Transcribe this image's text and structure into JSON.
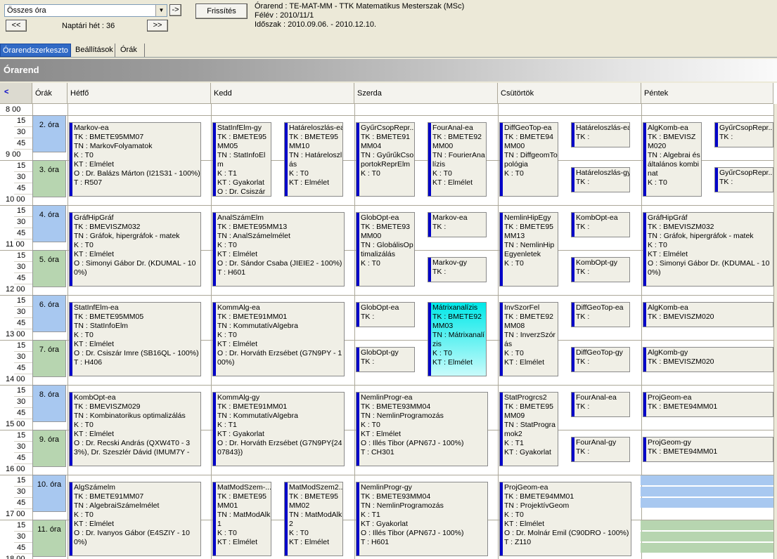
{
  "toolbar": {
    "combo_value": "Összes óra",
    "go_label": "->",
    "prev_label": "<<",
    "next_label": ">>",
    "week_label": "Naptári hét : 36",
    "refresh_label": "Frissítés"
  },
  "info": {
    "line1": "Órarend : TE-MAT-MM - TTK Matematikus Mesterszak (MSc)",
    "line2": "Félév : 2010/11/1",
    "line3": "Időszak : 2010.09.06. - 2010.12.10."
  },
  "tabs": [
    "Órarendszerkeszto",
    "Beállítások",
    "Órák"
  ],
  "banner": "Órarend",
  "columns": {
    "nav": "<",
    "periods": "Órák",
    "days": [
      "Hétfő",
      "Kedd",
      "Szerda",
      "Csütörtök",
      "Péntek"
    ]
  },
  "times": [
    "8 00",
    "15",
    "30",
    "45",
    "9 00",
    "15",
    "30",
    "45",
    "10 00",
    "15",
    "30",
    "45",
    "11 00",
    "15",
    "30",
    "45",
    "12 00",
    "15",
    "30",
    "45",
    "13 00",
    "15",
    "30",
    "45",
    "14 00",
    "15",
    "30",
    "45",
    "15 00",
    "15",
    "30",
    "45",
    "16 00",
    "15",
    "30",
    "45",
    "17 00",
    "15",
    "30",
    "45",
    "18 00"
  ],
  "periods": [
    "2. óra",
    "3. óra",
    "4. óra",
    "5. óra",
    "6. óra",
    "7. óra",
    "8. óra",
    "9. óra",
    "10. óra",
    "11. óra"
  ],
  "events": [
    {
      "title": "Markov-ea",
      "lines": [
        "TK : BMETE95MM07",
        "TN : MarkovFolyamatok",
        "K : T0",
        "KT : Elmélet",
        "O : Dr. Balázs Márton (I21S31 - 100%)",
        "T : R507"
      ]
    },
    {
      "title": "StatInfElm-gy",
      "lines": [
        "TK : BMETE95MM05",
        "TN : StatInfoElm",
        "K : T1",
        "KT : Gyakorlat",
        "O : Dr. Csiszár"
      ]
    },
    {
      "title": "Határeloszlás-ea",
      "lines": [
        "TK : BMETE95MM10",
        "TN : Határeloszlás",
        "K : T0",
        "KT : Elmélet"
      ]
    },
    {
      "title": "GyűrCsopRepr...",
      "lines": [
        "TK : BMETE91MM04",
        "TN : GyűrűkCsoportokReprElm",
        "K : T0"
      ]
    },
    {
      "title": "FourAnal-ea",
      "lines": [
        "TK : BMETE92MM00",
        "TN : FourierAnalízis",
        "K : T0",
        "KT : Elmélet"
      ]
    },
    {
      "title": "DiffGeoTop-ea",
      "lines": [
        "TK : BMETE94MM00",
        "TN : DiffgeomTopológia",
        "K : T0"
      ]
    },
    {
      "title": "Határeloszlás-ea",
      "lines": [
        "TK :"
      ]
    },
    {
      "title": "Határeloszlás-gy",
      "lines": [
        "TK :"
      ]
    },
    {
      "title": "AlgKomb-ea",
      "lines": [
        "TK : BMEVISZM020",
        "TN : Algebrai és általános kombinat",
        "K : T0"
      ]
    },
    {
      "title": "GyűrCsopRepr...",
      "lines": [
        "TK :"
      ]
    },
    {
      "title": "GyűrCsopRepr...",
      "lines": [
        "TK :"
      ]
    },
    {
      "title": "GráfHipGráf",
      "lines": [
        "TK : BMEVISZM032",
        "TN : Gráfok, hipergráfok - matek",
        "K : T0",
        "KT : Elmélet",
        "O : Simonyi Gábor Dr. (KDUMAL - 100%)"
      ]
    },
    {
      "title": "AnalSzámElm",
      "lines": [
        "TK : BMETE95MM13",
        "TN : AnalSzámelmélet",
        "K : T0",
        "KT : Elmélet",
        "O : Dr. Sándor Csaba (JIEIE2 - 100%)",
        "T : H601"
      ]
    },
    {
      "title": "GlobOpt-ea",
      "lines": [
        "TK : BMETE93MM00",
        "TN : GlobálisOptimalizálás",
        "K : T0"
      ]
    },
    {
      "title": "Markov-ea",
      "lines": [
        "TK :"
      ]
    },
    {
      "title": "Markov-gy",
      "lines": [
        "TK :"
      ]
    },
    {
      "title": "NemlinHipEgy",
      "lines": [
        "TK : BMETE95MM13",
        "TN : NemlinHipEgyenletek",
        "K : T0"
      ]
    },
    {
      "title": "KombOpt-ea",
      "lines": [
        "TK :"
      ]
    },
    {
      "title": "KombOpt-gy",
      "lines": [
        "TK :"
      ]
    },
    {
      "title": "GráfHipGráf",
      "lines": [
        "TK : BMEVISZM032",
        "TN : Gráfok, hipergráfok - matek",
        "K : T0",
        "KT : Elmélet",
        "O : Simonyi Gábor Dr. (KDUMAL - 100%)"
      ]
    },
    {
      "title": "StatInfElm-ea",
      "lines": [
        "TK : BMETE95MM05",
        "TN : StatInfoElm",
        "K : T0",
        "KT : Elmélet",
        "O : Dr. Csiszár Imre (SB16QL - 100%)",
        "T : H406"
      ]
    },
    {
      "title": "KommAlg-ea",
      "lines": [
        "TK : BMETE91MM01",
        "TN : KommutatívAlgebra",
        "K : T0",
        "KT : Elmélet",
        "O : Dr. Horváth Erzsébet (G7N9PY - 100%)"
      ]
    },
    {
      "title": "GlobOpt-ea",
      "lines": [
        "TK :"
      ]
    },
    {
      "title": "GlobOpt-gy",
      "lines": [
        "TK :"
      ]
    },
    {
      "title": "Mátrixanalízis",
      "lines": [
        "TK : BMETE92MM03",
        "TN : Mátrixanalízis",
        "K : T0",
        "KT : Elmélet"
      ]
    },
    {
      "title": "InvSzorFel",
      "lines": [
        "TK : BMETE92MM08",
        "TN : InverzSzórás",
        "K : T0",
        "KT : Elmélet"
      ]
    },
    {
      "title": "DiffGeoTop-ea",
      "lines": [
        "TK :"
      ]
    },
    {
      "title": "DiffGeoTop-gy",
      "lines": [
        "TK :"
      ]
    },
    {
      "title": "AlgKomb-ea",
      "lines": [
        "TK : BMEVISZM020"
      ]
    },
    {
      "title": "AlgKomb-gy",
      "lines": [
        "TK : BMEVISZM020"
      ]
    },
    {
      "title": "KombOpt-ea",
      "lines": [
        "TK : BMEVISZM029",
        "TN : Kombinatorikus optimalizálás",
        "K : T0",
        "KT : Elmélet",
        "O : Dr. Recski András (QXW4T0 - 33%), Dr. Szeszlér Dávid (IMUM7Y -"
      ]
    },
    {
      "title": "KommAlg-gy",
      "lines": [
        "TK : BMETE91MM01",
        "TN : KommutatívAlgebra",
        "K : T1",
        "KT : Gyakorlat",
        "O : Dr. Horváth Erzsébet (G7N9PY{2407843})"
      ]
    },
    {
      "title": "NemlinProgr-ea",
      "lines": [
        "TK : BMETE93MM04",
        "TN : NemlinProgramozás",
        "K : T0",
        "KT : Elmélet",
        "O : Illés Tibor (APN67J - 100%)",
        "T : CH301"
      ]
    },
    {
      "title": "StatProgrcs2",
      "lines": [
        "TK : BMETE95MM09",
        "TN : StatProgramok2",
        "K : T1",
        "KT : Gyakorlat"
      ]
    },
    {
      "title": "FourAnal-ea",
      "lines": [
        "TK :"
      ]
    },
    {
      "title": "FourAnal-gy",
      "lines": [
        "TK :"
      ]
    },
    {
      "title": "ProjGeom-ea",
      "lines": [
        "TK : BMETE94MM01"
      ]
    },
    {
      "title": "ProjGeom-gy",
      "lines": [
        "TK : BMETE94MM01"
      ]
    },
    {
      "title": "AlgSzámelm",
      "lines": [
        "TK : BMETE91MM07",
        "TN : AlgebraiSzámelmélet",
        "K : T0",
        "KT : Elmélet",
        "O : Dr. Ivanyos Gábor (E4SZIY - 100%)"
      ]
    },
    {
      "title": "MatModSzem-...",
      "lines": [
        "TK : BMETE95MM01",
        "TN : MatModAlk1",
        "K : T0",
        "KT : Elmélet"
      ]
    },
    {
      "title": "MatModSzem2...",
      "lines": [
        "TK : BMETE95MM02",
        "TN : MatModAlk2",
        "K : T0",
        "KT : Elmélet"
      ]
    },
    {
      "title": "NemlinProgr-gy",
      "lines": [
        "TK : BMETE93MM04",
        "TN : NemlinProgramozás",
        "K : T1",
        "KT : Gyakorlat",
        "O : Illés Tibor (APN67J - 100%)",
        "T : H601"
      ]
    },
    {
      "title": "ProjGeom-ea",
      "lines": [
        "TK : BMETE94MM01",
        "TN : ProjektívGeom",
        "K : T0",
        "KT : Elmélet",
        "O : Dr. Molnár Emil (C90DRO - 100%)",
        "T : Z110"
      ]
    }
  ]
}
